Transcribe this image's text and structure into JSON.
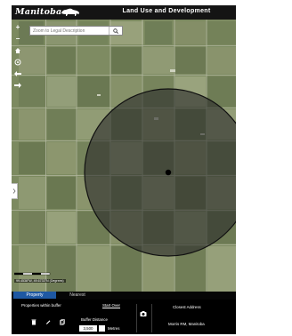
{
  "header": {
    "logo_text": "Manitoba",
    "title": "Land Use and Development"
  },
  "search": {
    "placeholder": "Zoom to Legal Description",
    "button_icon": "search-icon"
  },
  "map_tools": [
    {
      "name": "zoom-in",
      "icon": "plus-icon",
      "glyph": "+"
    },
    {
      "name": "zoom-out",
      "icon": "minus-icon",
      "glyph": "−"
    },
    {
      "name": "home",
      "icon": "home-icon"
    },
    {
      "name": "locate",
      "icon": "locate-icon"
    },
    {
      "name": "back",
      "icon": "back-arrow-icon"
    },
    {
      "name": "forward",
      "icon": "forward-arrow-icon"
    }
  ],
  "map": {
    "coords": "99.4538°W, 49.6733°N (Degrees)",
    "buffer_fill": "#2a2a2a",
    "center_marker_color": "#000000"
  },
  "panel": {
    "tabs": [
      {
        "label": "Property",
        "active": true
      },
      {
        "label": "Nearest",
        "active": false
      }
    ],
    "properties_label": "Properties within buffer",
    "start_over": "Start Over",
    "buffer_label": "Buffer Distance",
    "buffer_value": "3,500",
    "unit": "Metres",
    "closest_address_label": "Closest Address",
    "closest_address_value": "Morris RM, Manitoba"
  },
  "colors": {
    "tab_active": "#1e58a3",
    "header_bg": "#141414"
  }
}
